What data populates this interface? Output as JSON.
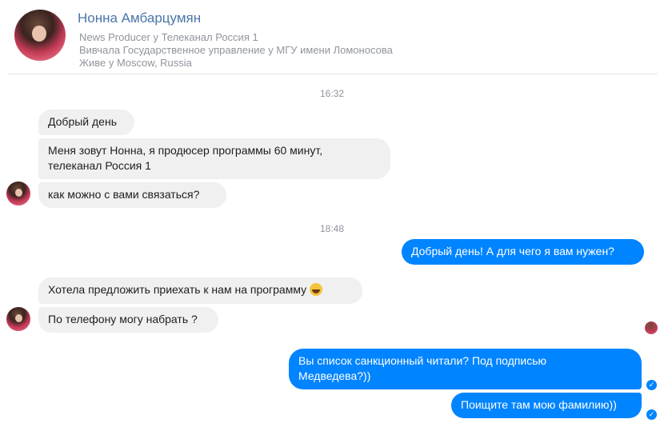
{
  "contact": {
    "name": "Нонна Амбарцумян",
    "lines": [
      "News Producer у Телеканал Россия 1",
      "Вивчала Государственное управление у МГУ имени Ломоносова",
      "Живе у Moscow, Russia"
    ]
  },
  "timestamps": [
    "16:32",
    "18:48"
  ],
  "messages": [
    {
      "from": "contact",
      "text": "Добрый день"
    },
    {
      "from": "contact",
      "text_line1": "Меня зовут Нонна, я продюсер программы 60 минут,",
      "text_line2": "телеканал Россия 1"
    },
    {
      "from": "contact",
      "text": "как  можно с вами связаться?"
    },
    {
      "from": "me",
      "text": "Добрый день! А для чего я вам нужен?"
    },
    {
      "from": "contact",
      "text": "Хотела предложить приехать к нам на программу",
      "emoji": "grinning-face-emoji"
    },
    {
      "from": "contact",
      "text": "По телефону могу набрать ?"
    },
    {
      "from": "me",
      "text_line1": "Вы список санкционный читали? Под подписью",
      "text_line2": "Медведева?))"
    },
    {
      "from": "me",
      "text": "Поищите там мою фамилию))"
    }
  ],
  "colors": {
    "outgoing": "#0084ff",
    "incoming": "#f1f0f0",
    "name": "#4a76a8"
  }
}
